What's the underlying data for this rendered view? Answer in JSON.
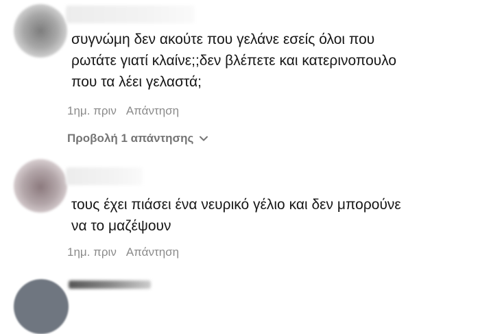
{
  "comments": [
    {
      "text_lines": [
        "συγνώμη δεν ακούτε που γελάνε εσείς όλοι που",
        "ρωτάτε γιατί κλαίνε;;δεν βλέπετε και κατερινοπουλο",
        "που τα λέει γελαστά;"
      ],
      "time": "1ημ. πριν",
      "reply_label": "Απάντηση",
      "view_replies_label": "Προβολή 1 απάντησης"
    },
    {
      "text_lines": [
        "τους έχει πιάσει ένα νευρικό γέλιο και δεν μπορούνε",
        "να το μαζέψουν"
      ],
      "time": "1ημ. πριν",
      "reply_label": "Απάντηση"
    }
  ],
  "icons": {
    "chevron": "chevron-down-icon"
  },
  "colors": {
    "meta": "#8a8a8a",
    "view_replies": "#757575",
    "text": "#161616"
  }
}
